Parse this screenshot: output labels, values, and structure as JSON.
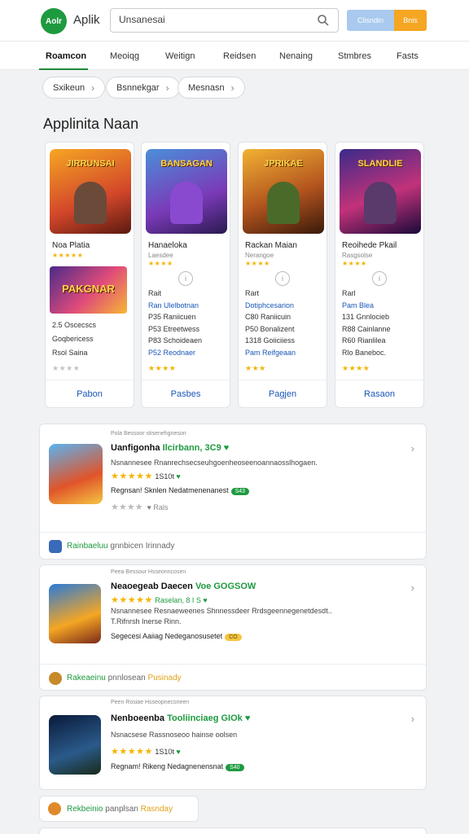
{
  "header": {
    "logo_mark": "Aolr",
    "logo_text": "Aplik",
    "search_value": "Unsanesai",
    "btn_primary": "Clisndin",
    "btn_secondary": "Bnis"
  },
  "tabs": [
    "Roamcon",
    "Meoiqg",
    "Weitign",
    "Reidsen",
    "Nenaing",
    "Stmbres",
    "Fasts"
  ],
  "chips": [
    "Sxikeun",
    "Bsnnekgar",
    "Mesnasn"
  ],
  "section": {
    "title": "Applinita Naan"
  },
  "games": [
    {
      "thumb_label": "JIRRUNSAI",
      "name": "Noa Platia",
      "stars": "★★★★★",
      "promo": "PAKGNAR",
      "lines": [
        "2.5  Oscecscs",
        "Goqbericess",
        "Rsol Saina"
      ],
      "bottom_stars": "★★★★",
      "link": "Pabon"
    },
    {
      "thumb_label": "BANSAGAN",
      "name": "Hanaeloka",
      "sub": "Laesdee",
      "stars": "★★★★",
      "info": "i",
      "lines": [
        "Rait",
        "Ran Ulelbotnan",
        "P35  Raniicuen",
        "P53  Etreetwess",
        "P83  Schoideaen",
        "P52  Reodnaer"
      ],
      "bottom_stars": "★★★★",
      "link": "Pasbes"
    },
    {
      "thumb_label": "JPRIKAE",
      "name": "Rackan Maian",
      "sub": "Nerangoe",
      "stars": "★★★★",
      "info": "i",
      "lines": [
        "Rart",
        "Dotiphcesarion",
        "C80  Raniicuin",
        "P50  Bonalizent",
        "1318  Goiiciiess",
        "Pam  Reifgeaan"
      ],
      "bottom_stars": "★★★",
      "link": "Pagjen"
    },
    {
      "thumb_label": "SLANDLIE",
      "name": "Reoihede Pkail",
      "sub": "Rasgsolse",
      "stars": "★★★★",
      "info": "i",
      "lines": [
        "Rarl",
        "Pam Blea",
        "131  Gnnlocieb",
        "R88  Cainlanne",
        "R60  Rianlilea",
        "Rlo  Baneboc."
      ],
      "bottom_stars": "★★★★",
      "link": "Rasaon"
    }
  ],
  "list": [
    {
      "tiny": "Pola Bessoor stisenehgneson",
      "title": "Uanfigonha",
      "title_green": "Ilcirbann, 3C9",
      "desc": "Nsnannesee  Rnanrechsecseuhgoenheoseenoannaosslhogaen.",
      "rating": "1S10t",
      "bottom": "Regnsan! Sknlen Nedatmenenanest",
      "pill": "S43",
      "sub": "Rals",
      "footer_green": "Rainbaeluu",
      "footer_mid": "gnnbicen",
      "footer_end": "Irinnady"
    },
    {
      "tiny": "Peea Bessour Hsseonncosen",
      "title": "Neaoegeab Daecen",
      "title_green": "Voe GOGSOW",
      "desc_1": "Nsnannesee  Resnaeweenes Shnnessdeer Rrdsgeennegenetdesdt..",
      "desc_2": "T.Rifnrsh Inerse Rinn.",
      "rating": "Raselan, 8 I S",
      "bottom": "Segecesi Aaiiag Nedeganosusetet",
      "pill": "CO",
      "footer_green": "Rakeaeinu",
      "footer_mid": "pnnlosean",
      "footer_end": "Pusinady"
    },
    {
      "tiny": "Peen Rosiae Hsseopnecsneen",
      "title": "Nenboeenba",
      "title_green": "Tooliinciaeg GIOk",
      "desc": "Nsnacsese  Rassnoseoo hainse oolsen",
      "rating": "1S10t",
      "bottom": "Regnam! Rikeng Nedagnenensnat",
      "pill": "S40"
    }
  ],
  "small_footer": {
    "green": "Rekbeinio",
    "mid": "panplsan",
    "end": "Rasnday"
  }
}
